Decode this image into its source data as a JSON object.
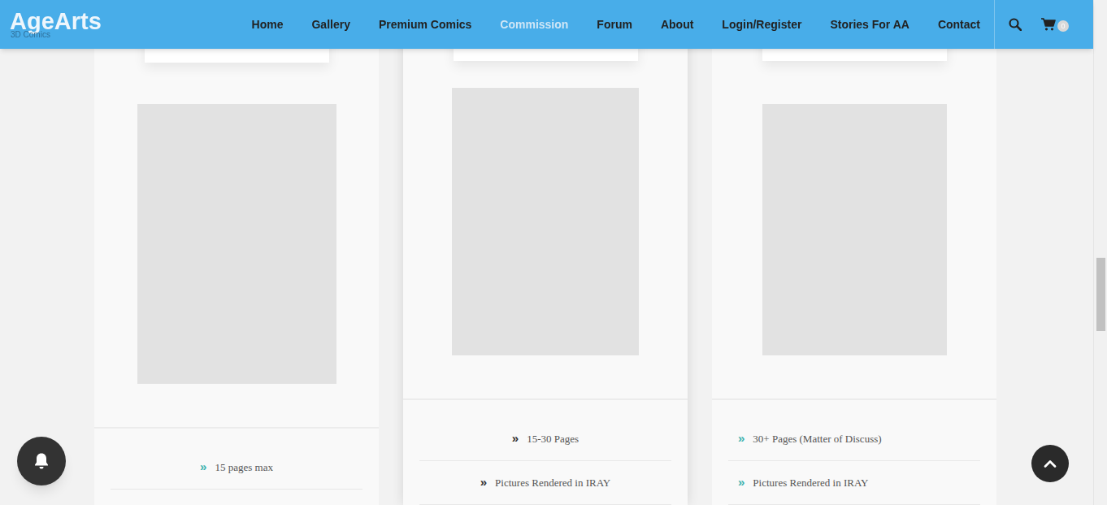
{
  "logo": {
    "title": "AgeArts",
    "subtitle": "3D Comics"
  },
  "nav": [
    {
      "label": "Home",
      "selected": false
    },
    {
      "label": "Gallery",
      "selected": false
    },
    {
      "label": "Premium Comics",
      "selected": false
    },
    {
      "label": "Commission",
      "selected": true
    },
    {
      "label": "Forum",
      "selected": false
    },
    {
      "label": "About",
      "selected": false
    },
    {
      "label": "Login/Register",
      "selected": false
    },
    {
      "label": "Stories For AA",
      "selected": false
    },
    {
      "label": "Contact",
      "selected": false
    }
  ],
  "cart": {
    "count": "0"
  },
  "plans": [
    {
      "featured": false,
      "features": [
        {
          "icon": "»",
          "text": "15 pages max"
        }
      ]
    },
    {
      "featured": true,
      "features": [
        {
          "icon": "»",
          "text": "15-30 Pages"
        },
        {
          "icon": "»",
          "text": "Pictures Rendered in IRAY"
        }
      ]
    },
    {
      "featured": false,
      "features": [
        {
          "icon": "»",
          "text": "30+ Pages (Matter of Discuss)"
        },
        {
          "icon": "»",
          "text": "Pictures Rendered in IRAY"
        }
      ]
    }
  ]
}
